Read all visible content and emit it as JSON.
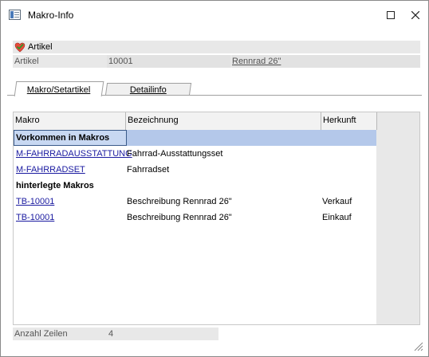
{
  "window": {
    "title": "Makro-Info"
  },
  "article_section": {
    "title": "Artikel",
    "field_label": "Artikel",
    "number": "10001",
    "name": "Rennrad 26\""
  },
  "tabs": [
    {
      "label": "Makro/Setartikel",
      "active": true
    },
    {
      "label": "Detailinfo",
      "active": false
    }
  ],
  "grid": {
    "columns": [
      "Makro",
      "Bezeichnung",
      "Herkunft"
    ],
    "rows": [
      {
        "type": "group",
        "makro": "Vorkommen in Makros",
        "bezeichnung": "",
        "herkunft": "",
        "selected": true
      },
      {
        "type": "data",
        "makro": "M-FAHRRADAUSSTATTUNG",
        "bezeichnung": "Fahrrad-Ausstattungsset",
        "herkunft": ""
      },
      {
        "type": "data",
        "makro": "M-FAHRRADSET",
        "bezeichnung": "Fahrradset",
        "herkunft": ""
      },
      {
        "type": "group",
        "makro": "hinterlegte Makros",
        "bezeichnung": "",
        "herkunft": ""
      },
      {
        "type": "data",
        "makro": "TB-10001",
        "bezeichnung": "Beschreibung Rennrad 26\"",
        "herkunft": "Verkauf"
      },
      {
        "type": "data",
        "makro": "TB-10001",
        "bezeichnung": "Beschreibung Rennrad 26\"",
        "herkunft": "Einkauf"
      }
    ]
  },
  "footer": {
    "row_count_label": "Anzahl Zeilen",
    "row_count": "4"
  },
  "colors": {
    "selection": "#b4c8ea",
    "link": "#1a1aa0",
    "field_bg": "#e8e8e8"
  },
  "icons": {
    "app": "window-app-icon",
    "article": "heart-check-icon",
    "maximize": "maximize-icon",
    "close": "close-icon",
    "resize": "resize-grip-icon"
  }
}
